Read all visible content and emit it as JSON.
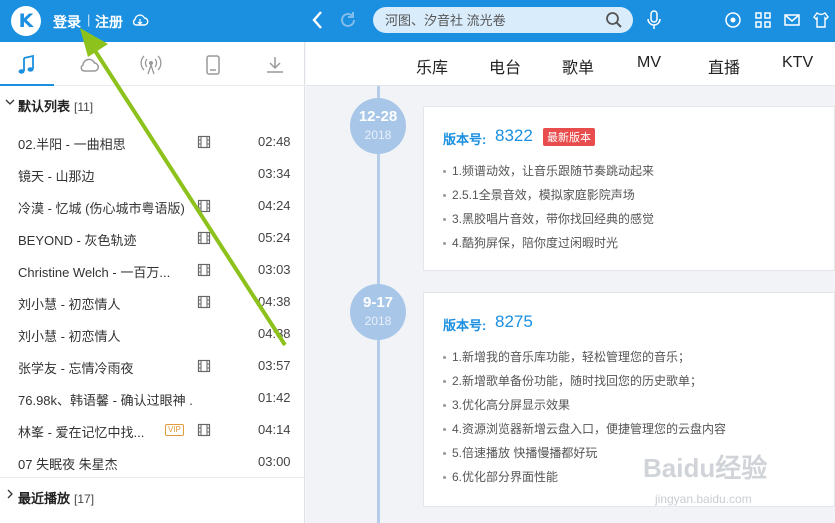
{
  "topbar": {
    "logo_letter": "K",
    "login": "登录",
    "separator": "|",
    "register": "注册",
    "search_placeholder": "河图、汐音社 流光卷"
  },
  "left_tabs": [
    "music-note-icon",
    "cloud-icon",
    "radio-icon",
    "device-icon",
    "download-icon"
  ],
  "default_list": {
    "title": "默认列表",
    "count": "[11]",
    "tracks": [
      {
        "name": "02.半阳 - 一曲相思",
        "duration": "02:48",
        "mv": true,
        "vip": false
      },
      {
        "name": "镜天 - 山那边",
        "duration": "03:34",
        "mv": false,
        "vip": false
      },
      {
        "name": "冷漠 - 忆城 (伤心城市粤语版)",
        "duration": "04:24",
        "mv": true,
        "vip": false
      },
      {
        "name": "BEYOND - 灰色轨迹",
        "duration": "05:24",
        "mv": true,
        "vip": false
      },
      {
        "name": "Christine Welch - 一百万...",
        "duration": "03:03",
        "mv": true,
        "vip": false
      },
      {
        "name": "刘小慧 - 初恋情人",
        "duration": "04:38",
        "mv": true,
        "vip": false
      },
      {
        "name": "刘小慧 - 初恋情人",
        "duration": "04:38",
        "mv": false,
        "vip": false
      },
      {
        "name": "张学友 - 忘情冷雨夜",
        "duration": "03:57",
        "mv": true,
        "vip": false
      },
      {
        "name": "76.98k、韩语馨 - 确认过眼神 ...",
        "duration": "01:42",
        "mv": false,
        "vip": false
      },
      {
        "name": "林峯 - 爱在记忆中找...",
        "duration": "04:14",
        "mv": true,
        "vip": true
      },
      {
        "name": "07 失眠夜 朱星杰",
        "duration": "03:00",
        "mv": false,
        "vip": false
      }
    ]
  },
  "recent": {
    "title": "最近播放",
    "count": "[17]"
  },
  "vip_label": "VIP",
  "main_nav": [
    "乐库",
    "电台",
    "歌单",
    "MV",
    "直播",
    "KTV"
  ],
  "releases": [
    {
      "date": "12-28",
      "year": "2018",
      "label": "版本号:",
      "version": "8322",
      "badge": "最新版本",
      "features": [
        "1.频谱动效，让音乐跟随节奏跳动起来",
        "2.5.1全景音效，模拟家庭影院声场",
        "3.黑胶唱片音效，带你找回经典的感觉",
        "4.酷狗屏保，陪你度过闲暇时光"
      ]
    },
    {
      "date": "9-17",
      "year": "2018",
      "label": "版本号:",
      "version": "8275",
      "badge": "",
      "features": [
        "1.新增我的音乐库功能，轻松管理您的音乐；",
        "2.新增歌单备份功能，随时找回您的历史歌单；",
        "3.优化高分屏显示效果",
        "4.资源浏览器新增云盘入口，便捷管理您的云盘内容",
        "5.倍速播放 快播慢播都好玩",
        "6.优化部分界面性能"
      ]
    }
  ],
  "watermark": {
    "text": "Baidu经验",
    "sub": "jingyan.baidu.com"
  },
  "colors": {
    "brand": "#1b8fe0",
    "badge": "#e84c4c",
    "annotation_arrow": "#8cc21b"
  }
}
